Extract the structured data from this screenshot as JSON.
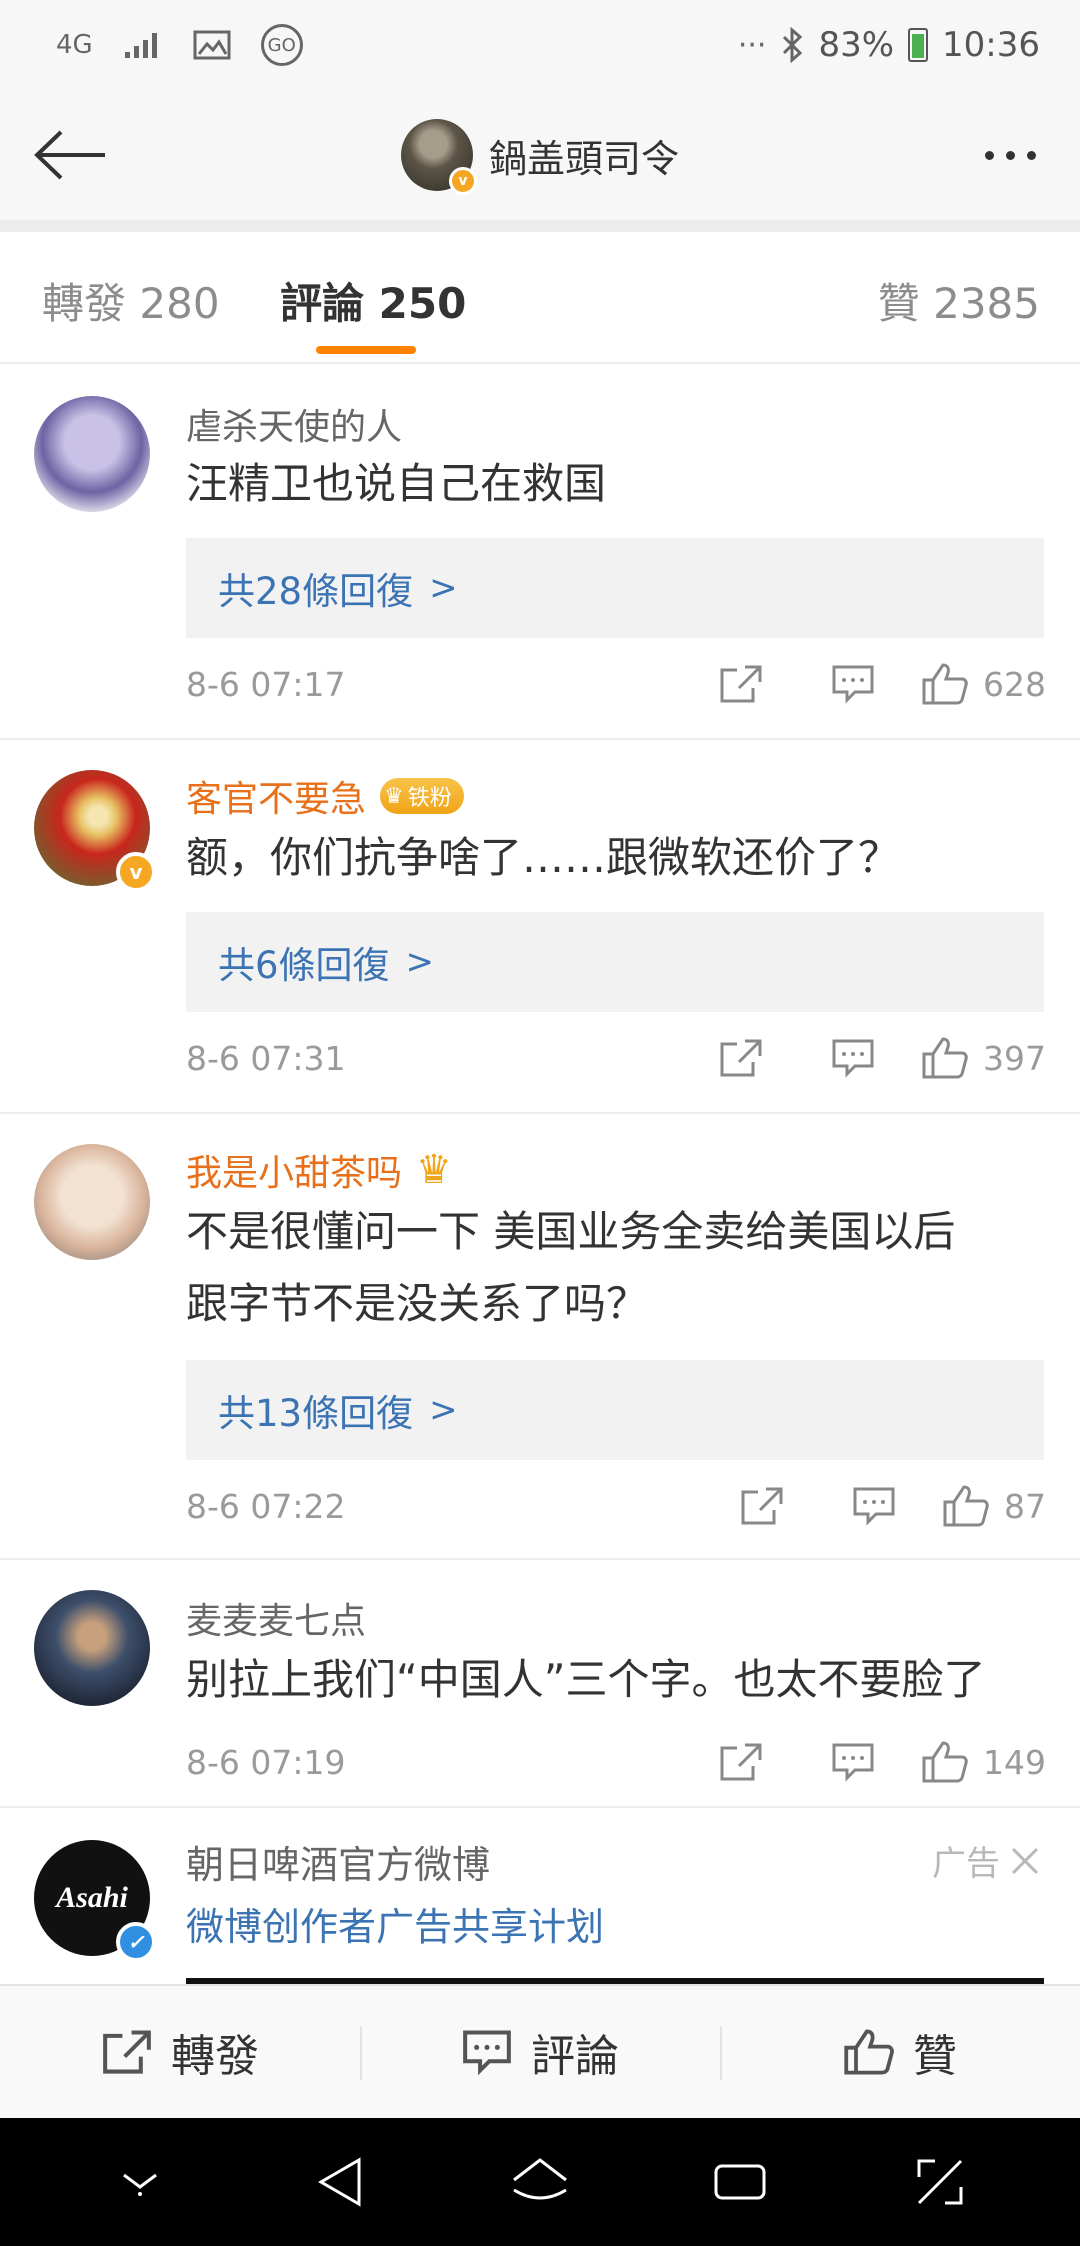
{
  "status_bar": {
    "network": "4G",
    "app_badge": "GO",
    "battery": "83%",
    "time": "10:36"
  },
  "header": {
    "username": "鍋盖頭司令"
  },
  "tabs": {
    "repost_label": "轉發",
    "repost_count": "280",
    "comment_label": "評論",
    "comment_count": "250",
    "like_label": "贊",
    "like_count": "2385"
  },
  "comments": [
    {
      "username": "虐杀天使的人",
      "text": "汪精卫也说自己在救国",
      "replies": "共28條回復",
      "time": "8-6 07:17",
      "likes": "628"
    },
    {
      "username": "客官不要急",
      "fan_badge": "铁粉",
      "text": "额，你们抗争啥了……跟微软还价了？",
      "replies": "共6條回復",
      "time": "8-6 07:31",
      "likes": "397"
    },
    {
      "username": "我是小甜茶吗",
      "text_line1": "不是很懂问一下 美国业务全卖给美国以后",
      "text_line2": "跟字节不是没关系了吗？",
      "replies": "共13條回復",
      "time": "8-6 07:22",
      "likes": "87"
    },
    {
      "username": "麦麦麦七点",
      "text": "别拉上我们“中国人”三个字。也太不要脸了",
      "time": "8-6 07:19",
      "likes": "149"
    }
  ],
  "ad": {
    "name": "朝日啤酒官方微博",
    "logo_text": "Asahi",
    "link": "微博创作者广告共享计划",
    "tag": "广告"
  },
  "bottom_bar": {
    "repost": "轉發",
    "comment": "評論",
    "like": "贊"
  },
  "colors": {
    "accent": "#ff8200",
    "link": "#3b73b3",
    "vip_name": "#e8701a"
  }
}
